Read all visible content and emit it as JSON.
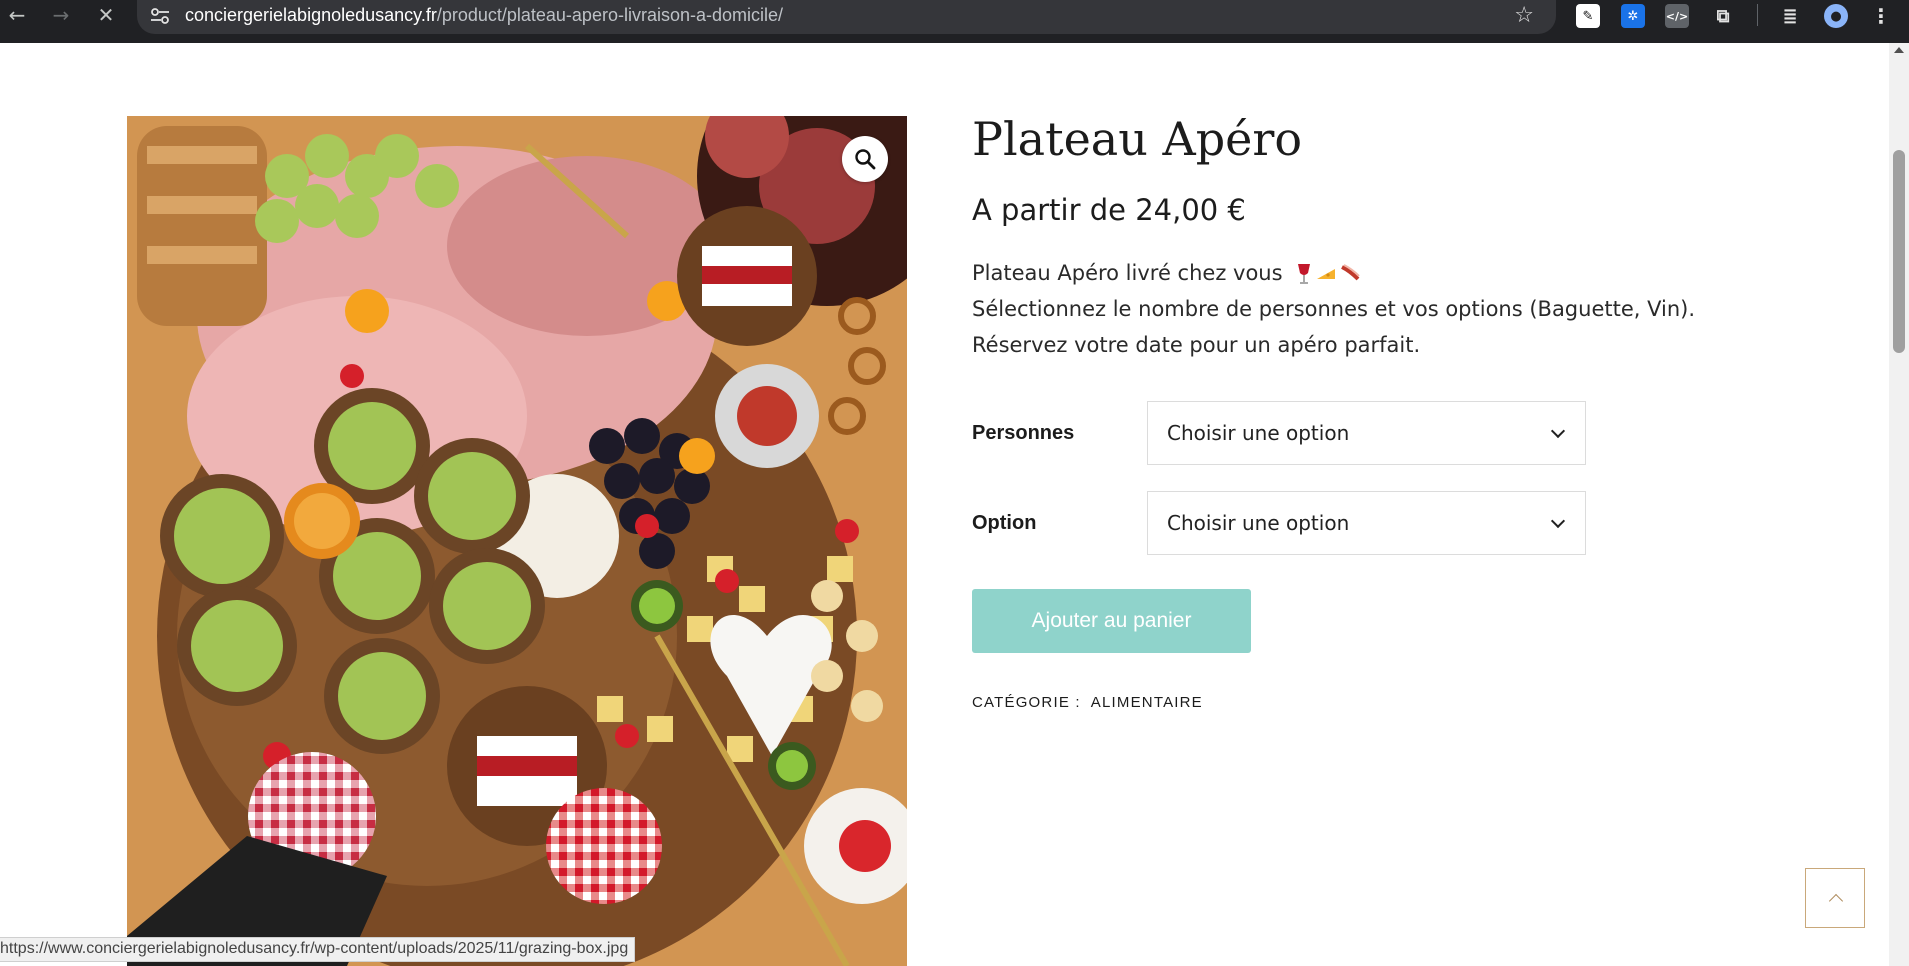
{
  "browser": {
    "url_host": "conciergerielabignoledusancy.fr",
    "url_path": "/product/plateau-apero-livraison-a-domicile/",
    "status_url": "https://www.conciergerielabignoledusancy.fr/wp-content/uploads/2025/11/grazing-box.jpg",
    "icons": {
      "back": "back-arrow-icon",
      "forward": "forward-arrow-icon",
      "stop": "stop-loading-icon",
      "site_info": "site-info-icon",
      "bookmark": "star-icon",
      "menu": "kebab-menu-icon"
    }
  },
  "product": {
    "title": "Plateau Apéro",
    "price": "A partir de 24,00 €",
    "description": [
      "Plateau Apéro livré chez vous",
      "Sélectionnez le nombre de personnes et vos options (Baguette, Vin).",
      "Réservez votre date pour un apéro parfait."
    ],
    "variations": [
      {
        "label": "Personnes",
        "value": "Choisir une option"
      },
      {
        "label": "Option",
        "value": "Choisir une option"
      }
    ],
    "add_to_cart": "Ajouter au panier",
    "category_label": "CATÉGORIE :",
    "category_value": "ALIMENTAIRE"
  },
  "colors": {
    "button": "#8fd3cb",
    "back_to_top_border": "#c9a87a",
    "chrome_bg": "#202124"
  }
}
